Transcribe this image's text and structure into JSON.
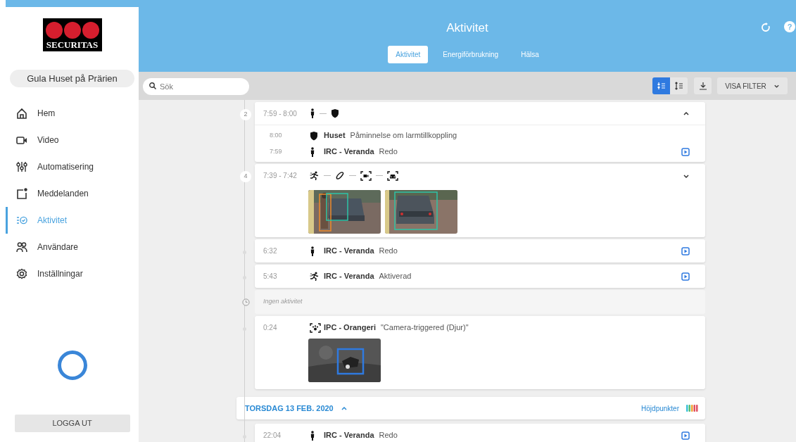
{
  "sidebar": {
    "logo": "SECURITAS",
    "site": "Gula Huset på Prärien",
    "nav": [
      {
        "label": "Hem",
        "kind": "home",
        "selected": false
      },
      {
        "label": "Video",
        "kind": "video",
        "selected": false
      },
      {
        "label": "Automatisering",
        "kind": "sliders",
        "selected": false
      },
      {
        "label": "Meddelanden",
        "kind": "message",
        "selected": false
      },
      {
        "label": "Aktivitet",
        "kind": "activity",
        "selected": true
      },
      {
        "label": "Användare",
        "kind": "users",
        "selected": false
      },
      {
        "label": "Inställningar",
        "kind": "settings",
        "selected": false
      }
    ],
    "logout": "LOGGA UT"
  },
  "header": {
    "title": "Aktivitet",
    "help": "?",
    "tabs": [
      {
        "label": "Aktivitet",
        "selected": true
      },
      {
        "label": "Energiförbrukning",
        "selected": false
      },
      {
        "label": "Hälsa",
        "selected": false
      }
    ]
  },
  "toolbar": {
    "search": {
      "placeholder": "Sök"
    },
    "views": [
      {
        "kind": "compact",
        "selected": true
      },
      {
        "kind": "expand",
        "selected": false
      }
    ],
    "filter": "VISA FILTER"
  },
  "timeline": [
    {
      "kind": "group",
      "count": "2",
      "time": "7:59 - 8:00",
      "icons": [
        {
          "kind": "person"
        },
        {
          "kind": "shield"
        }
      ],
      "expanded": true,
      "events": [
        {
          "time": "8:00",
          "marker": {
            "kind": "shield"
          },
          "device": "Huset",
          "status": "Påminnelse om larmtillkoppling",
          "video": false
        },
        {
          "time": "7:59",
          "marker": {
            "kind": "person"
          },
          "device": "IRC - Veranda",
          "status": "Redo",
          "video": true
        }
      ]
    },
    {
      "kind": "group",
      "count": "4",
      "time": "7:39 - 7:42",
      "icons": [
        {
          "kind": "motion"
        },
        {
          "kind": "link"
        },
        {
          "kind": "camera"
        },
        {
          "kind": "car"
        }
      ],
      "expanded": false
    },
    {
      "kind": "event",
      "time": "6:32",
      "marker": {
        "kind": "person"
      },
      "device": "IRC - Veranda",
      "status": "Redo",
      "video": true
    },
    {
      "kind": "event",
      "time": "5:43",
      "marker": {
        "kind": "motion"
      },
      "device": "IRC - Veranda",
      "status": "Aktiverad",
      "video": true
    },
    {
      "kind": "empty",
      "text": "Ingen aktivitet"
    },
    {
      "kind": "event",
      "time": "0:24",
      "marker": {
        "kind": "animal"
      },
      "device": "IPC - Orangeri",
      "status": "\"Camera-triggered (Djur)\"",
      "video": false
    },
    {
      "kind": "day",
      "label": "TORSDAG 13 FEB. 2020",
      "expanded": true,
      "highlights": "Höjdpunkter"
    },
    {
      "kind": "event",
      "time": "22:04",
      "marker": {
        "kind": "person"
      },
      "device": "IRC - Veranda",
      "status": "Redo",
      "video": true
    }
  ]
}
